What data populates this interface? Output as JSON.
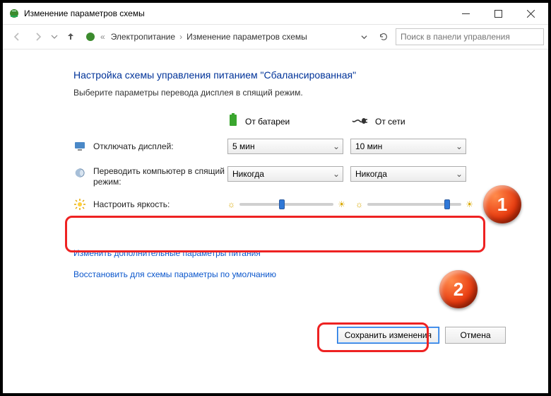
{
  "titlebar": {
    "title": "Изменение параметров схемы"
  },
  "breadcrumb": {
    "item1": "Электропитание",
    "item2": "Изменение параметров схемы"
  },
  "search": {
    "placeholder": "Поиск в панели управления"
  },
  "heading": "Настройка схемы управления питанием \"Сбалансированная\"",
  "subtext": "Выберите параметры перевода дисплея в спящий режим.",
  "col_battery": "От батареи",
  "col_ac": "От сети",
  "row_display": {
    "label": "Отключать дисплей:",
    "battery": "5 мин",
    "ac": "10 мин"
  },
  "row_sleep": {
    "label": "Переводить компьютер в спящий режим:",
    "battery": "Никогда",
    "ac": "Никогда"
  },
  "row_bright": {
    "label": "Настроить яркость:"
  },
  "link_advanced": "Изменить дополнительные параметры питания",
  "link_restore": "Восстановить для схемы параметры по умолчанию",
  "btn_save": "Сохранить изменения",
  "btn_cancel": "Отмена",
  "callouts": {
    "1": "1",
    "2": "2"
  }
}
